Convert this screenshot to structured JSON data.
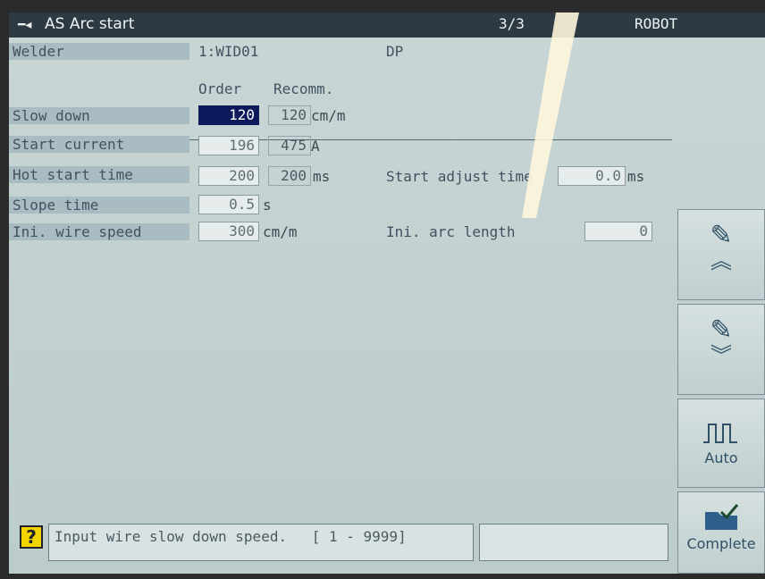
{
  "title_bar": {
    "icon": "plug-icon",
    "title": "AS Arc start",
    "page": "3/3",
    "mode": "ROBOT"
  },
  "welder": {
    "label": "Welder",
    "value": "1:WID01",
    "process": "DP"
  },
  "columns": {
    "order": "Order",
    "recomm": "Recomm."
  },
  "params": {
    "slow_down": {
      "label": "Slow down",
      "order": "120",
      "recomm": "120",
      "unit": "cm/m"
    },
    "start_current": {
      "label": "Start current",
      "order": "196",
      "recomm": "475",
      "unit": "A"
    },
    "hot_start_time": {
      "label": "Hot start time",
      "order": "200",
      "recomm": "200",
      "unit": "ms"
    },
    "start_adjust_time": {
      "label": "Start adjust time",
      "value": "0.0",
      "unit": "ms"
    },
    "slope_time": {
      "label": "Slope time",
      "value": "0.5",
      "unit": "s"
    },
    "ini_wire_speed": {
      "label": "Ini. wire speed",
      "value": "300",
      "unit": "cm/m"
    },
    "ini_arc_length": {
      "label": "Ini. arc length",
      "value": "0"
    }
  },
  "side_buttons": {
    "page_up": {
      "icon": "book-pen-icon",
      "arrow": "chevron-double-up-icon"
    },
    "page_down": {
      "icon": "book-pen-icon",
      "arrow": "chevron-double-down-icon"
    },
    "auto": {
      "icon": "pulse-wave-icon",
      "label": "Auto"
    },
    "complete": {
      "icon": "folder-check-icon",
      "label": "Complete"
    }
  },
  "status": {
    "help_icon": "question-icon",
    "message": "Input wire slow down speed.",
    "range": "[   1 - 9999]"
  },
  "colors": {
    "title_bg": "#2d3a44",
    "screen_bg": "#c6d4d4",
    "active_field": "#0c1a5c"
  }
}
